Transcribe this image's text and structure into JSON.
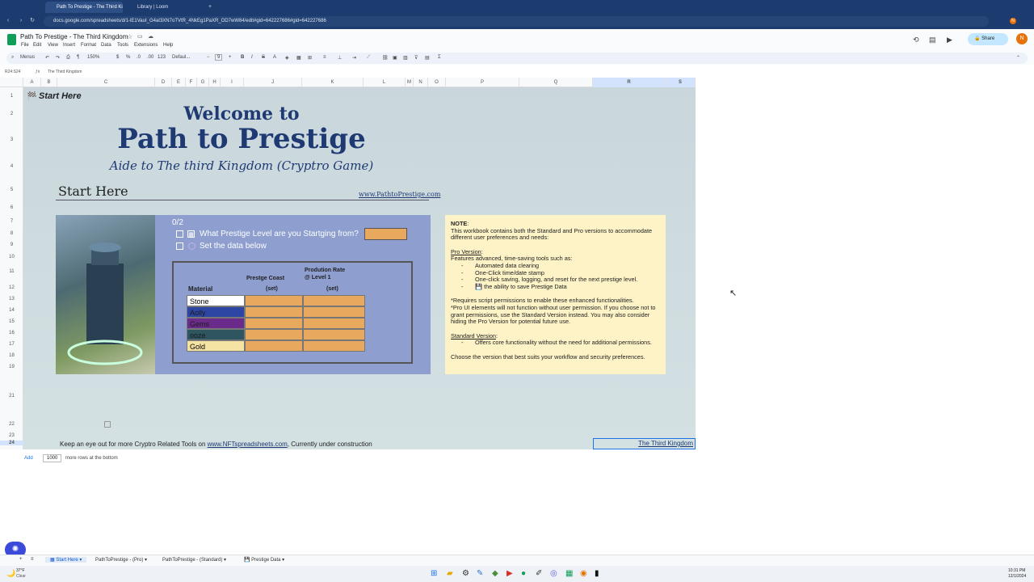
{
  "browser": {
    "tabs": [
      {
        "title": "Path To Prestige - The Third Ki"
      },
      {
        "title": "Library | Loom"
      }
    ],
    "url": "docs.google.com/spreadsheets/d/1-lE1VauI_G4aI3XN7oTVtR_4NkEg1PaXR_OD7wW84/edit#gid=642227686#gid=642227686"
  },
  "doc": {
    "title": "Path To Prestige - The Third Kingdom",
    "menus": [
      "File",
      "Edit",
      "View",
      "Insert",
      "Format",
      "Data",
      "Tools",
      "Extensions",
      "Help"
    ],
    "share_label": "Share",
    "avatar_letter": "N"
  },
  "toolbar": {
    "search_label": "Menus",
    "zoom": "150%",
    "currency": "$",
    "percent": "%",
    "dec_less": ".0",
    "dec_more": ".00",
    "number_format": "123",
    "font": "Defaul...",
    "font_size": "9"
  },
  "formula_bar": {
    "cell_ref": "R24:S24",
    "value": "The Third Kingdom"
  },
  "columns": [
    "A",
    "B",
    "C",
    "D",
    "E",
    "F",
    "G",
    "H",
    "I",
    "J",
    "K",
    "L",
    "M",
    "N",
    "O",
    "P",
    "Q",
    "R",
    "S"
  ],
  "rows": [
    "1",
    "2",
    "3",
    "4",
    "5",
    "6",
    "7",
    "8",
    "9",
    "10",
    "11",
    "12",
    "13",
    "14",
    "15",
    "16",
    "17",
    "18",
    "19",
    "21",
    "22",
    "23",
    "24"
  ],
  "content": {
    "start_here_small": "Start Here",
    "welcome": "Welcome to",
    "title": "Path to Prestige",
    "subtitle": "Aide to The third Kingdom (Cryptro Game)",
    "start_here": "Start Here",
    "website": "www.PathtoPrestige.com",
    "progress": "0/2",
    "task1": "What Prestige Level are you Startging from?",
    "task2": "Set the data below",
    "col_cost_1": "Prestge Coast",
    "col_cost_2": "(set)",
    "col_rate_1": "Prodution Rate",
    "col_rate_2": "@ Level 1",
    "col_rate_3": "(set)",
    "col_material": "Material",
    "materials": [
      {
        "name": "Stone",
        "color": "#ffffff"
      },
      {
        "name": "Aolly",
        "color": "#2e46a3"
      },
      {
        "name": "Gems",
        "color": "#6b2b8a"
      },
      {
        "name": "ooze",
        "color": "#2e5560"
      },
      {
        "name": "Gold",
        "color": "#f4e3a2"
      }
    ],
    "footer_text": "Keep an eye out for more Cryptro Related Tools on ",
    "footer_link": "www.NFTspreadsheets.com",
    "footer_suffix": ", Currently under construction",
    "kingdom_link": "The Third Kingdom"
  },
  "note": {
    "heading": "NOTE",
    "intro": "This workbook contains both the Standard and Pro versions to accommodate different user preferences and needs:",
    "pro_heading": "Pro Version",
    "pro_intro": "Features advanced, time-saving tools such as:",
    "pro_items": [
      "Automated data clearing",
      "One-Click time/date stamp",
      "One-click saving, logging, and reset for the next prestige level.",
      "💾 the ability to save Prestige Data"
    ],
    "req1": "*Requires script permissions to enable these enhanced functionalities.",
    "req2": "*Pro UI elements will not function without user permission. If you choose not to grant permissions, use the Standard Version instead. You may also consider hiding the Pro Version for potential future use.",
    "std_heading": "Standard Version",
    "std_items": [
      "Offers core functionality without the need for additional permissions."
    ],
    "closing": "Choose the version that best suits your workflow and security preferences."
  },
  "add_rows": {
    "label": "Add",
    "count": "1000",
    "suffix": "more rows at the bottom"
  },
  "sheet_tabs": [
    "Start Here",
    "PathToPrestige - (Pro)",
    "PathToPrestige - (Standard)",
    "Prestige Data"
  ],
  "taskbar": {
    "weather_temp": "37°F",
    "weather_desc": "Clear",
    "time": "10:31 PM",
    "date": "12/1/2024"
  },
  "colors": {
    "accent": "#1f3a73",
    "orange_cell": "#e8a95e",
    "panel": "#8e9fcf",
    "note_bg": "#fdf3c7"
  }
}
